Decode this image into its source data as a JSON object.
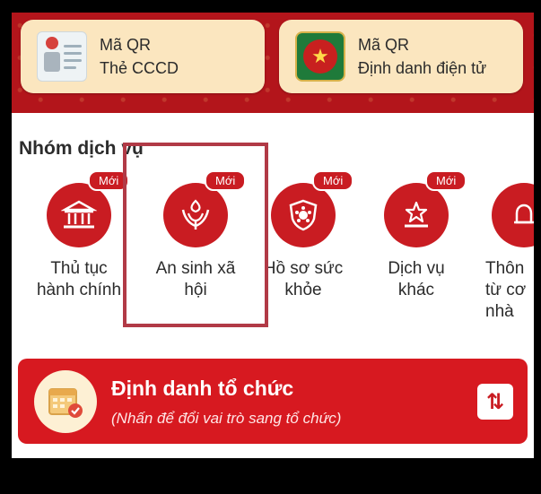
{
  "qr_cards": [
    {
      "title": "Mã QR",
      "subtitle": "Thẻ CCCD",
      "icon": "id-card-icon"
    },
    {
      "title": "Mã QR",
      "subtitle": "Định danh điện tử",
      "icon": "police-badge-icon"
    }
  ],
  "section": {
    "title": "Nhóm dịch vụ"
  },
  "services": [
    {
      "line1": "Thủ tục",
      "line2": "hành chính",
      "badge": "Mới",
      "icon": "government-building-icon"
    },
    {
      "line1": "An sinh xã",
      "line2": "hội",
      "badge": "Mới",
      "icon": "social-welfare-icon"
    },
    {
      "line1": "Hồ sơ sức",
      "line2": "khỏe",
      "badge": "Mới",
      "icon": "health-shield-icon"
    },
    {
      "line1": "Dịch vụ",
      "line2": "khác",
      "badge": "Mới",
      "icon": "star-podium-icon"
    },
    {
      "line1": "Thôn",
      "line2": "từ cơ",
      "line3": "nhà",
      "badge": "",
      "icon": "bell-icon"
    }
  ],
  "org_card": {
    "title": "Định danh tổ chức",
    "subtitle": "(Nhấn để đổi vai trò sang tổ chức)",
    "switch_icon": "swap-arrows-icon"
  },
  "colors": {
    "brand_red": "#c91c22",
    "card_cream": "#fbe6bf",
    "highlight": "#b13a46"
  }
}
